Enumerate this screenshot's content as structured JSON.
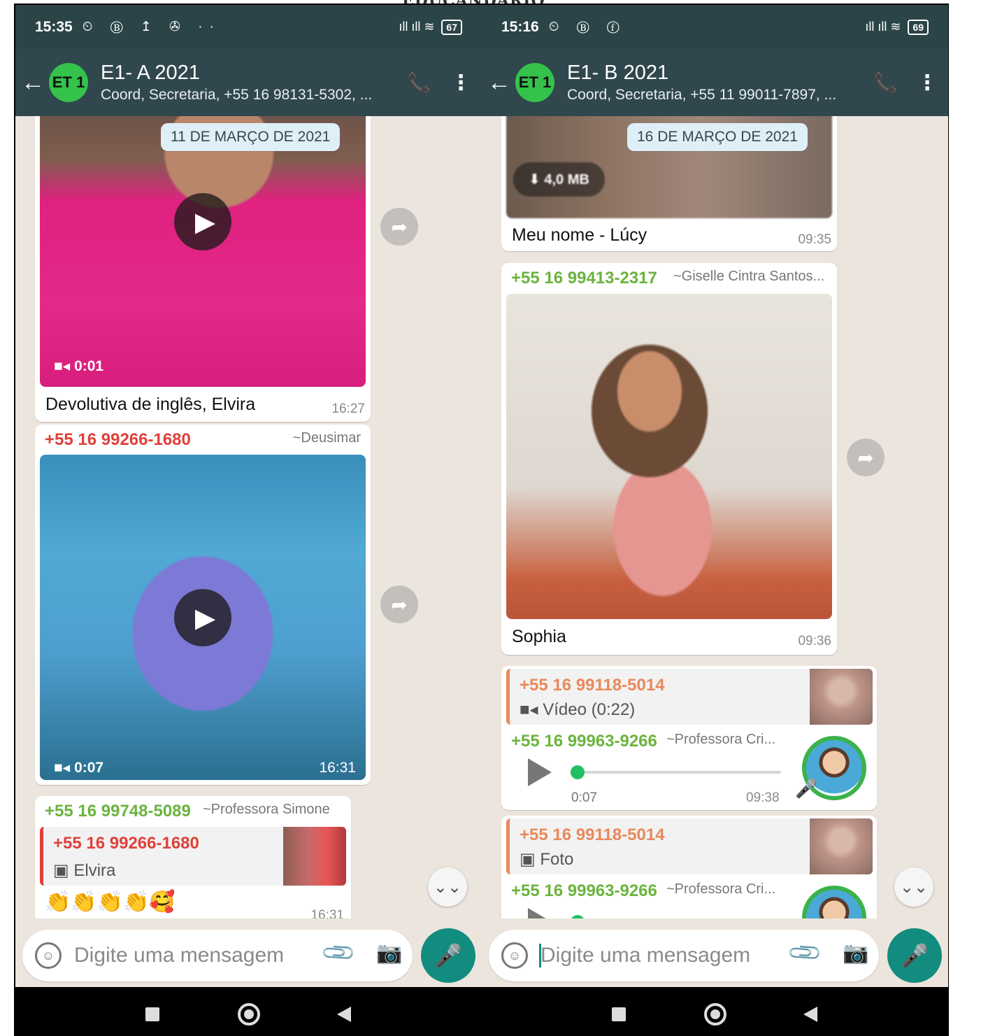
{
  "top_logo_text": "EDUCANDARIO",
  "left": {
    "status": {
      "time": "15:35",
      "left_icons": "⏲ Ⓑ ↥ ✇ ··",
      "signal": "ıll ıll ≋",
      "battery": "67"
    },
    "header": {
      "avatar": "ET 1",
      "title": "E1- A 2021",
      "subtitle": "Coord, Secretaria, +55 16 98131-5302, ..."
    },
    "date_chip": "11 DE MARÇO DE 2021",
    "messages": [
      {
        "type": "video",
        "duration": "0:01",
        "caption": "Devolutiva de inglês, Elvira",
        "time": "16:27"
      },
      {
        "type": "video",
        "sender": "+55 16 99266-1680",
        "sender_name": "~Deusimar",
        "duration": "0:07",
        "time": "16:31"
      },
      {
        "type": "reply",
        "sender": "+55 16 99748-5089",
        "sender_name": "~Professora Simone",
        "quote_sender": "+55 16 99266-1680",
        "quote_text": "Elvira",
        "body": "👏👏👏👏🥰",
        "time": "16:31"
      }
    ],
    "composer": {
      "placeholder": "Digite uma mensagem"
    }
  },
  "right": {
    "status": {
      "time": "15:16",
      "left_icons": "⏲ Ⓑ ⓕ",
      "signal": "ıll ıll ≋",
      "battery": "69"
    },
    "header": {
      "avatar": "ET 1",
      "title": "E1- B 2021",
      "subtitle": "Coord, Secretaria, +55 11 99011-7897, ..."
    },
    "date_chip": "16 DE MARÇO DE 2021",
    "messages": [
      {
        "type": "video",
        "download_size": "4,0 MB",
        "caption": "Meu nome - Lúcy",
        "time": "09:35"
      },
      {
        "type": "image",
        "sender": "+55 16 99413-2317",
        "sender_name": "~Giselle Cintra Santos...",
        "caption": "Sophia",
        "time": "09:36"
      },
      {
        "type": "audio_reply",
        "quote_sender": "+55 16 99118-5014",
        "quote_text": "Vídeo (0:22)",
        "sender": "+55 16 99963-9266",
        "sender_name": "~Professora Cri...",
        "audio_duration": "0:07",
        "time": "09:38"
      },
      {
        "type": "audio_reply",
        "quote_sender": "+55 16 99118-5014",
        "quote_text": "Foto",
        "sender": "+55 16 99963-9266",
        "sender_name": "~Professora Cri..."
      }
    ],
    "composer": {
      "placeholder": "Digite uma mensagem"
    }
  },
  "icons": {
    "back": "←",
    "call": "📞",
    "menu": "⋮",
    "play": "▶",
    "forward": "➦",
    "video_cam": "■◂",
    "image": "▣",
    "download": "⬇",
    "scroll_down": "⌄⌄",
    "emoji": "☺",
    "attach": "📎",
    "camera": "📷",
    "mic": "🎤"
  },
  "colors": {
    "header": "#2f474d",
    "status_bar": "#2b4448",
    "chat_bg": "#ece5dd",
    "avatar": "#35c24a",
    "sender_red": "#e0403a",
    "sender_green": "#6cb33f",
    "sender_orange": "#e8895b",
    "accent": "#128c7e"
  }
}
